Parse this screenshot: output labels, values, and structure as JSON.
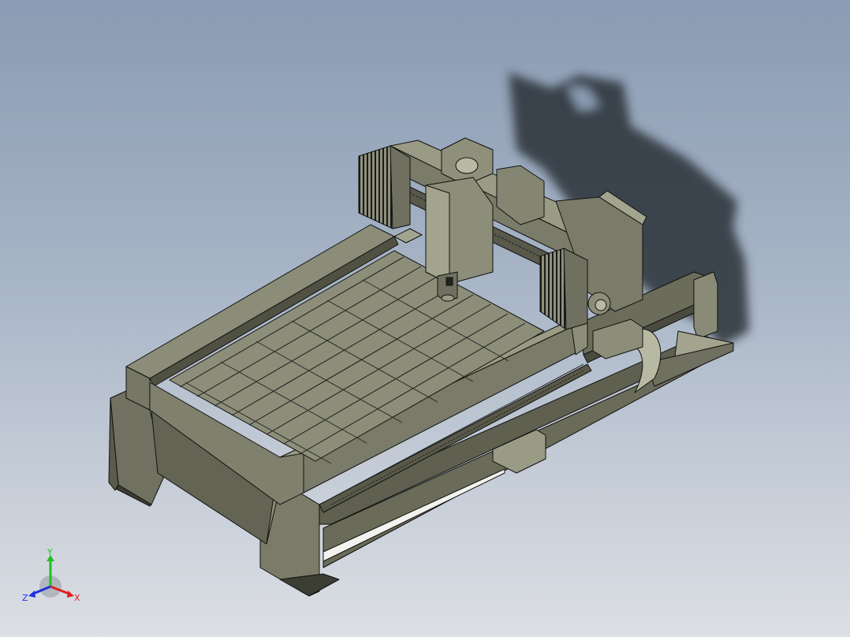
{
  "viewport": {
    "background_top": "#8a9bb3",
    "background_bottom": "#dcdfe4"
  },
  "model": {
    "body_color": "#6f705f",
    "body_light": "#a3a48e",
    "body_dark": "#4f5043",
    "edge_color": "#111111",
    "shadow_color": "#2c3038"
  },
  "triad": {
    "x_label": "X",
    "y_label": "Y",
    "z_label": "Z",
    "x_color": "#e02020",
    "y_color": "#20c020",
    "z_color": "#2030e0"
  }
}
